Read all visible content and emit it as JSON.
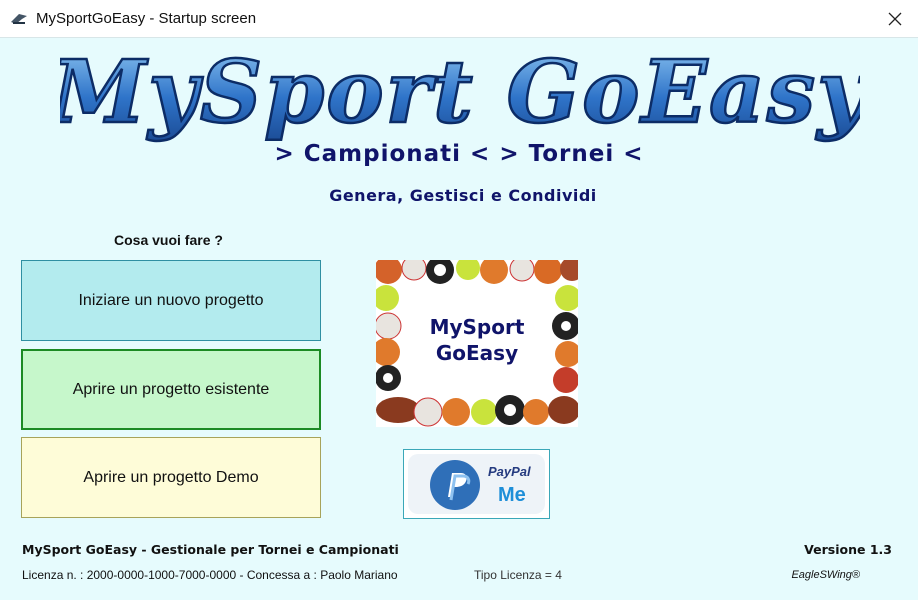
{
  "window": {
    "title": "MySportGoEasy - Startup screen",
    "icons": [
      "app-icon",
      "close-icon"
    ]
  },
  "header": {
    "logo_text": "MySport GoEasy",
    "subtitle": "> Campionati < > Tornei <",
    "tagline": "Genera, Gestisci e Condividi"
  },
  "menu": {
    "question": "Cosa vuoi fare ?",
    "new_project": "Iniziare un nuovo progetto",
    "open_project": "Aprire un progetto esistente",
    "demo_project": "Aprire un progetto Demo"
  },
  "image": {
    "line1": "MySport",
    "line2": "GoEasy"
  },
  "paypal": {
    "word1": "PayPal",
    "word2": "Me"
  },
  "footer": {
    "title": "MySport GoEasy - Gestionale per Tornei e Campionati",
    "version": "Versione 1.3",
    "license": "Licenza n. : 2000-0000-1000-7000-0000  -  Concessa a : Paolo Mariano",
    "license_type": "Tipo Licenza = 4",
    "brand": "EagleSWing®"
  },
  "colors": {
    "background": "#e6fbfd",
    "logo_blue": "#3b7fd0",
    "navy": "#10146a",
    "btn_new": "#b3ebee",
    "btn_open": "#c6f7cb",
    "btn_demo": "#fefcd8"
  }
}
